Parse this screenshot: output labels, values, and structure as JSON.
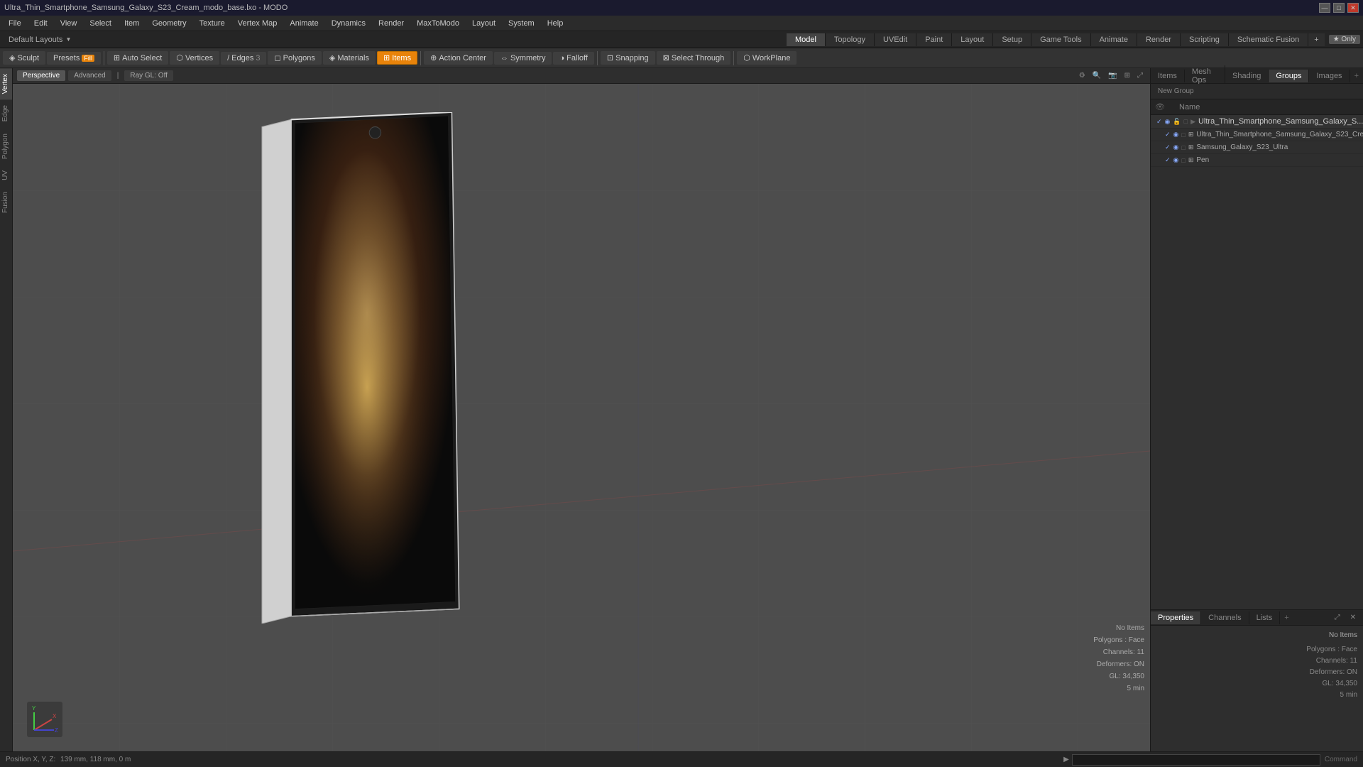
{
  "titlebar": {
    "title": "Ultra_Thin_Smartphone_Samsung_Galaxy_S23_Cream_modo_base.lxo - MODO",
    "controls": [
      "—",
      "□",
      "✕"
    ]
  },
  "menubar": {
    "items": [
      "File",
      "Edit",
      "View",
      "Select",
      "Item",
      "Geometry",
      "Texture",
      "Vertex Map",
      "Animate",
      "Dynamics",
      "Render",
      "MaxToModo",
      "Layout",
      "System",
      "Help"
    ]
  },
  "layoutbar": {
    "label": "Default Layouts",
    "tabs": [
      {
        "label": "Model",
        "active": true
      },
      {
        "label": "Topology",
        "active": false
      },
      {
        "label": "UVEdit",
        "active": false
      },
      {
        "label": "Paint",
        "active": false
      },
      {
        "label": "Layout",
        "active": false
      },
      {
        "label": "Setup",
        "active": false
      },
      {
        "label": "Game Tools",
        "active": false
      },
      {
        "label": "Animate",
        "active": false
      },
      {
        "label": "Render",
        "active": false
      },
      {
        "label": "Scripting",
        "active": false
      },
      {
        "label": "Schematic Fusion",
        "active": false
      }
    ],
    "star_label": "★ Only"
  },
  "toolbar": {
    "sculpt_label": "Sculpt",
    "presets_label": "Presets",
    "autoselect_label": "Auto Select",
    "vertices_label": "Vertices",
    "edges_label": "Edges",
    "polygons_label": "Polygons",
    "materials_label": "Materials",
    "items_label": "Items",
    "action_center_label": "Action Center",
    "symmetry_label": "Symmetry",
    "falloff_label": "Falloff",
    "snapping_label": "Snapping",
    "select_through_label": "Select Through",
    "workplane_label": "WorkPlane"
  },
  "left_tabs": {
    "items": [
      "Vertex",
      "Edge",
      "Polygon",
      "UV",
      "Fusion"
    ]
  },
  "viewport": {
    "view_mode": "Perspective",
    "advanced_label": "Advanced",
    "ray_gl_label": "Ray GL: Off"
  },
  "right_panel": {
    "tabs": [
      "Items",
      "Mesh Ops",
      "Shading",
      "Groups",
      "Images"
    ],
    "active_tab": "Groups",
    "new_group_label": "New Group",
    "name_col": "Name",
    "scene_items": [
      {
        "label": "Ultra_Thin_Smartphone_Samsung_Galaxy_S...",
        "type": "group",
        "visible": true
      },
      {
        "label": "Ultra_Thin_Smartphone_Samsung_Galaxy_S23_Cre...",
        "type": "item",
        "visible": true
      },
      {
        "label": "Samsung_Galaxy_S23_Ultra",
        "type": "item",
        "visible": true
      },
      {
        "label": "Pen",
        "type": "item",
        "visible": true
      }
    ]
  },
  "info_panel": {
    "tabs": [
      "Properties",
      "Channels",
      "Lists"
    ],
    "no_items_label": "No Items",
    "polygons_label": "Polygons : Face",
    "channels_label": "Channels: 11",
    "deformers_label": "Deformers: ON",
    "gl_label": "GL: 34,350",
    "time_label": "5 min"
  },
  "statusbar": {
    "position_label": "Position X, Y, Z:",
    "position_value": "139 mm, 118 mm, 0 m",
    "command_label": "Command",
    "command_placeholder": ""
  }
}
